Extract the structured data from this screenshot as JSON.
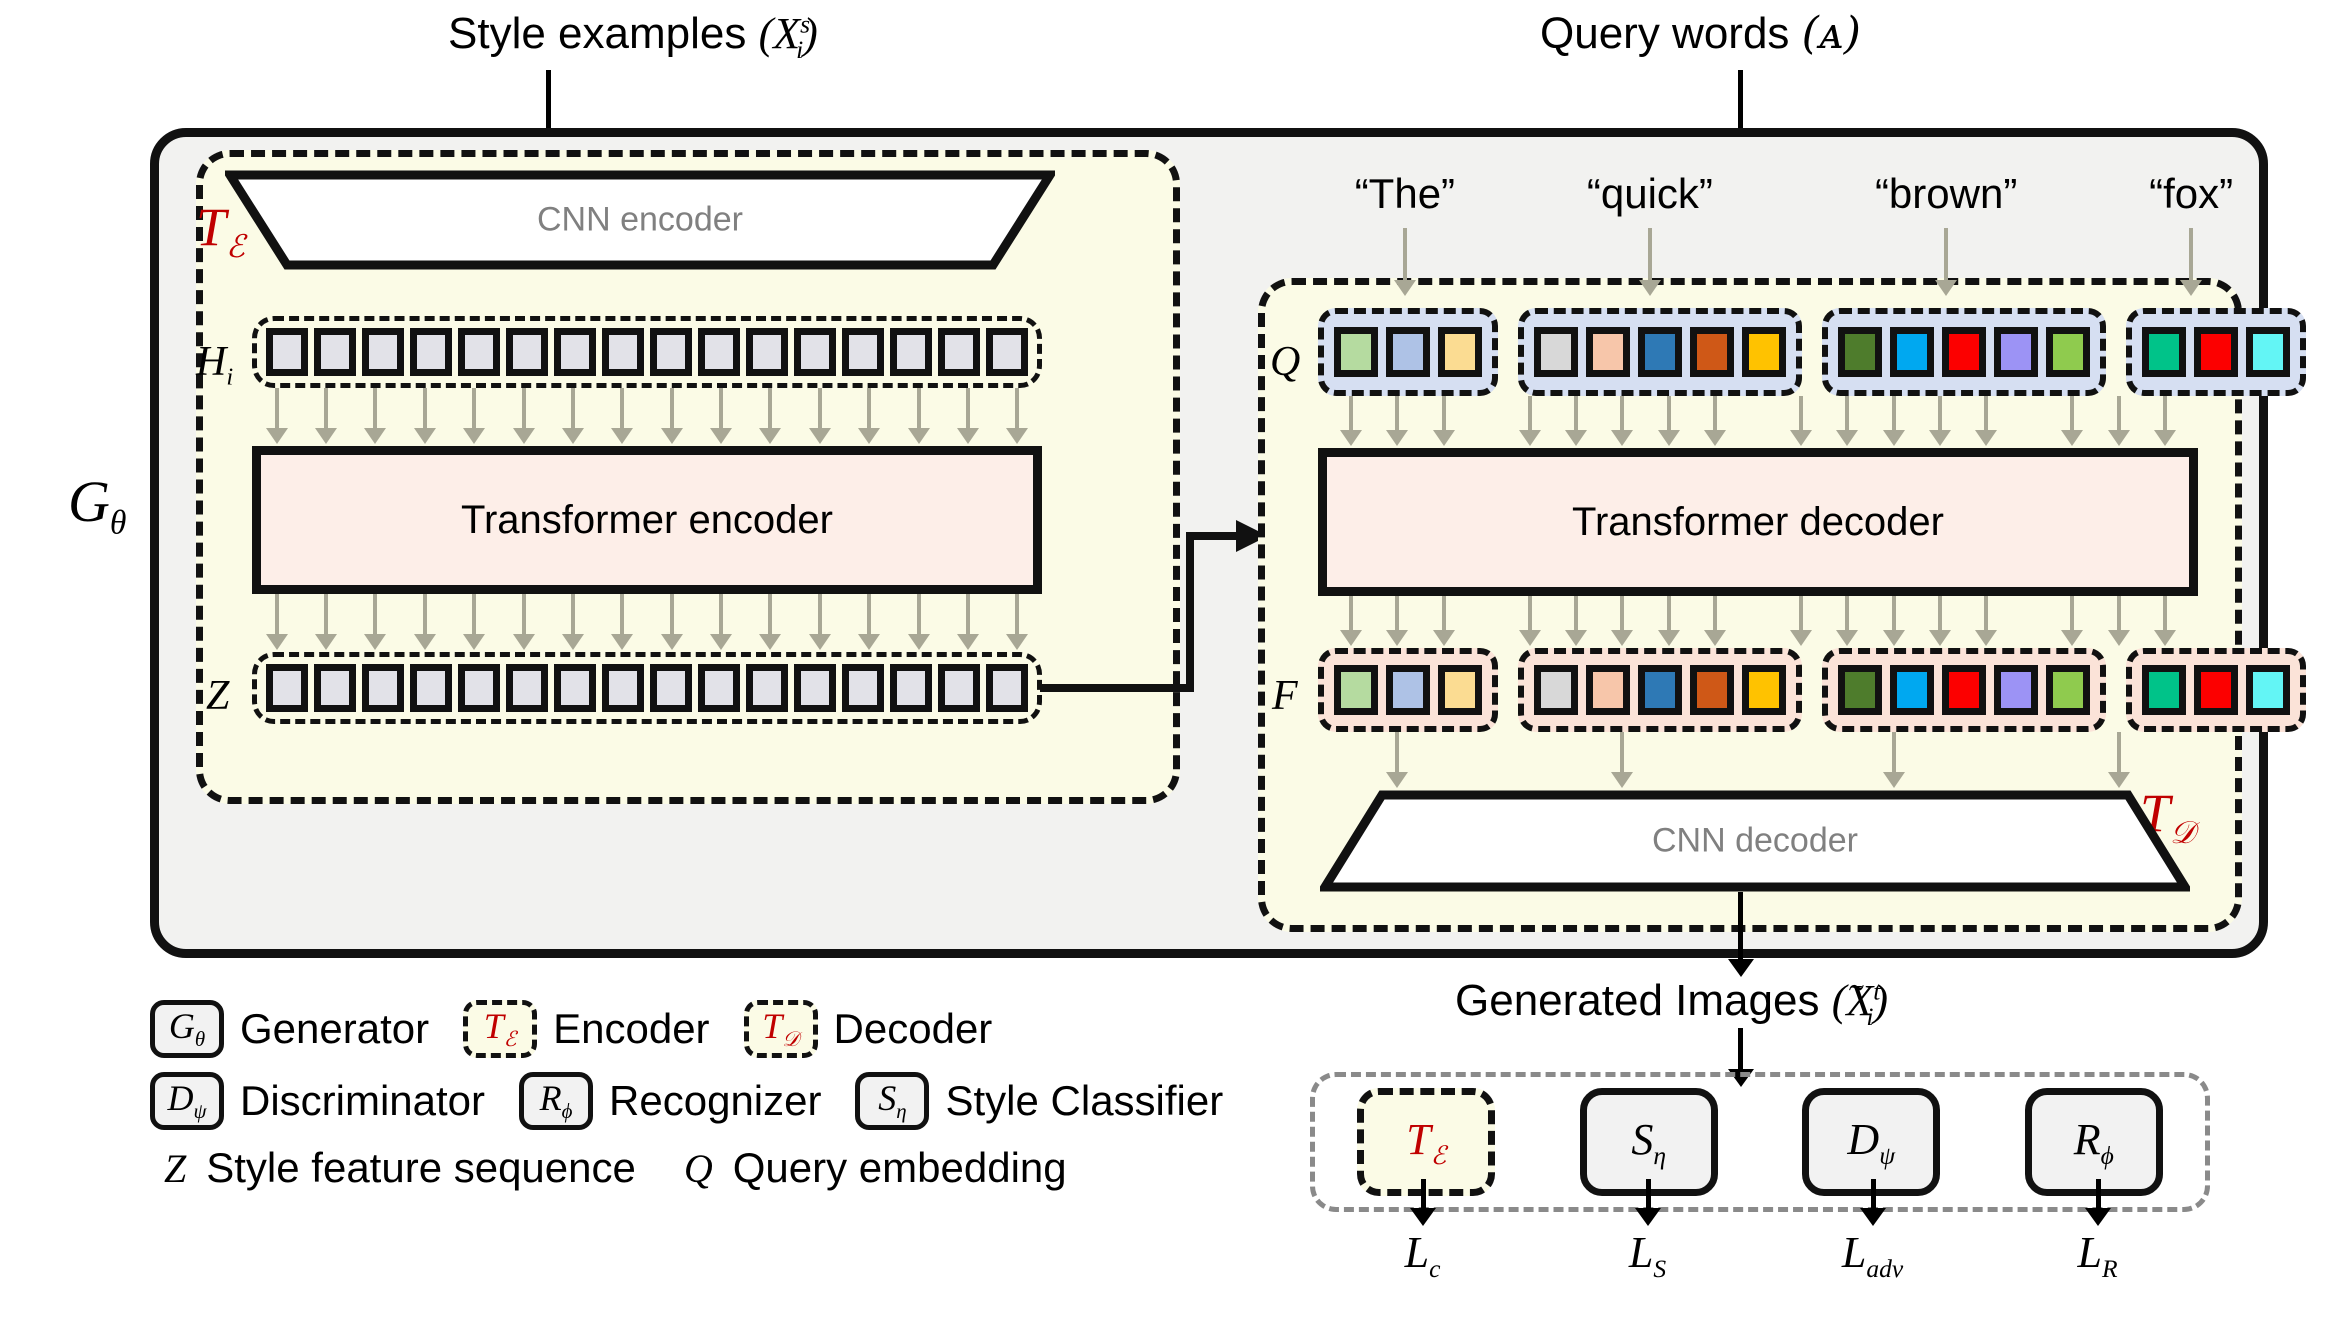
{
  "captions": {
    "style_examples": "Style examples",
    "style_examples_sym": "X",
    "style_examples_sup": "s",
    "style_examples_sub": "i",
    "query_words": "Query words",
    "query_words_sym": "ᴀ",
    "generated_images": "Generated Images",
    "generated_images_sym": "X",
    "generated_images_sup": "t",
    "generated_images_sub": "i"
  },
  "generator": {
    "label_sym": "G",
    "label_sub": "θ"
  },
  "encoder": {
    "tag_sym": "T",
    "tag_sub": "ℰ",
    "cnn_label": "CNN encoder",
    "hi_label_sym": "H",
    "hi_label_sub": "i",
    "hi_cells": 16,
    "transformer_label": "Transformer encoder",
    "z_label": "Z",
    "z_cells": 16
  },
  "decoder": {
    "tag_sym": "T",
    "tag_sub": "𝒟",
    "q_label": "Q",
    "f_label": "F",
    "transformer_label": "Transformer decoder",
    "cnn_label": "CNN decoder",
    "words": [
      {
        "text": "“The”",
        "colors": [
          "#b5dba0",
          "#aec2e6",
          "#fbdc92"
        ]
      },
      {
        "text": "“quick”",
        "colors": [
          "#d8d8d8",
          "#f7c6aa",
          "#2e79b5",
          "#cf5817",
          "#ffc200"
        ]
      },
      {
        "text": "“brown”",
        "colors": [
          "#4e7c2c",
          "#00a8f0",
          "#fc0000",
          "#9c93f5",
          "#8fcb4e"
        ]
      },
      {
        "text": "“fox”",
        "colors": [
          "#00c389",
          "#fc0000",
          "#63f5f5"
        ]
      }
    ]
  },
  "legend": {
    "rows": [
      [
        {
          "sym": "G",
          "sub": "θ",
          "style": "solid",
          "text": "Generator"
        },
        {
          "sym": "T",
          "sub": "ℰ",
          "style": "dashed",
          "text": "Encoder"
        },
        {
          "sym": "T",
          "sub": "𝒟",
          "style": "dashed",
          "text": "Decoder"
        }
      ],
      [
        {
          "sym": "D",
          "sub": "ψ",
          "style": "solid",
          "text": "Discriminator"
        },
        {
          "sym": "R",
          "sub": "ϕ",
          "style": "solid",
          "text": "Recognizer"
        },
        {
          "sym": "S",
          "sub": "η",
          "style": "solid",
          "text": "Style Classifier"
        }
      ]
    ],
    "plain_row": [
      {
        "sym": "Z",
        "text": "Style feature sequence"
      },
      {
        "sym": "Q",
        "text": "Query embedding"
      }
    ]
  },
  "losses": {
    "modules": [
      {
        "sym": "T",
        "sub": "ℰ",
        "style": "dashed",
        "loss_sym": "L",
        "loss_sub": "c"
      },
      {
        "sym": "S",
        "sub": "η",
        "style": "solid",
        "loss_sym": "L",
        "loss_sub": "S"
      },
      {
        "sym": "D",
        "sub": "ψ",
        "style": "solid",
        "loss_sym": "L",
        "loss_sub": "adv"
      },
      {
        "sym": "R",
        "sub": "ϕ",
        "style": "solid",
        "loss_sym": "L",
        "loss_sub": "R"
      }
    ]
  },
  "colors": {
    "accent_red": "#c00000",
    "panel_yellow": "#fbfbe6",
    "transformer_pink": "#fdeee8",
    "q_group_blue": "#d6dff2",
    "f_group_peach": "#fbe3d8",
    "arrow_grey": "#a8a795",
    "outer_grey": "#f2f2f0"
  }
}
